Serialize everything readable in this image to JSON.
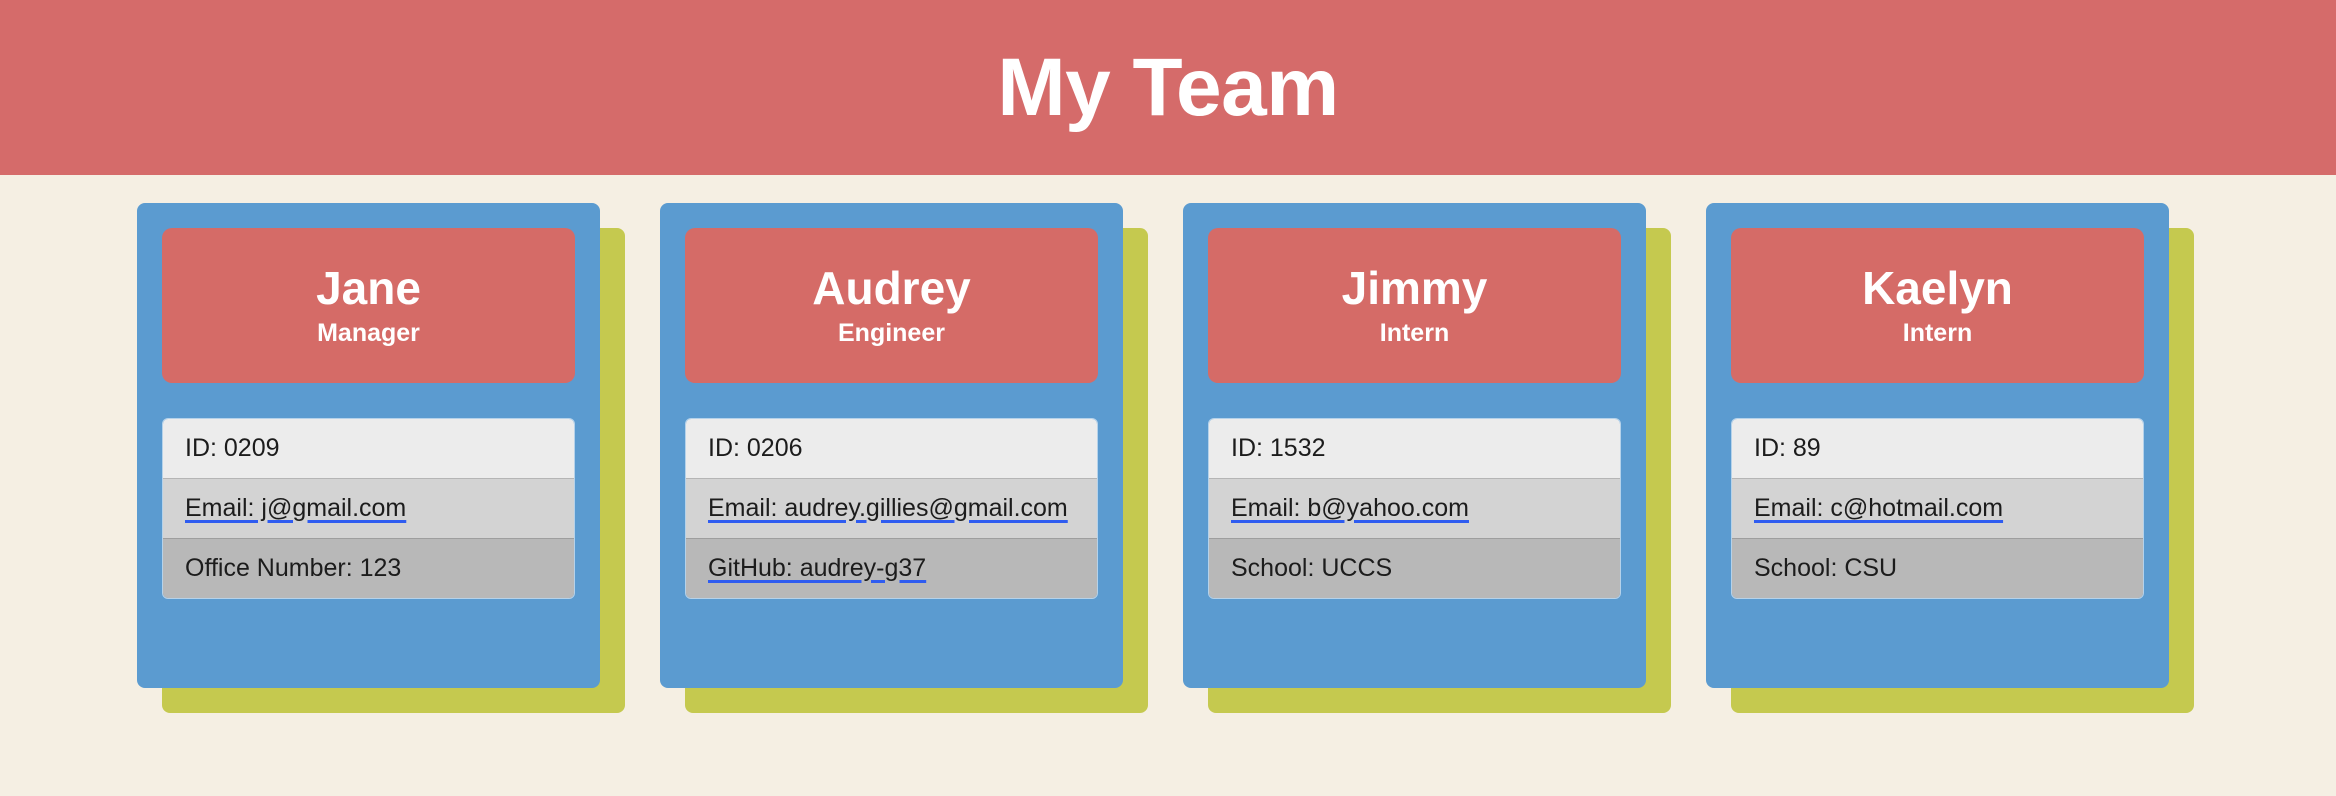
{
  "header": {
    "title": "My Team"
  },
  "colors": {
    "header_bar": "#d56b6a",
    "page_background": "#f5efe3",
    "card_background": "#5b9bd0",
    "card_header": "#d56b67",
    "card_shadow": "#c5c94f",
    "list_shade_light": "#ececec",
    "list_shade_medium": "#d3d3d3",
    "list_shade_dark": "#b8b8b8",
    "link_underline": "#2f5cf0"
  },
  "team": [
    {
      "name": "Jane",
      "role": "Manager",
      "details": [
        {
          "text": "ID: 0209",
          "link": false
        },
        {
          "text": "Email: j@gmail.com",
          "link": true
        },
        {
          "text": "Office Number: 123",
          "link": false
        }
      ]
    },
    {
      "name": "Audrey",
      "role": "Engineer",
      "details": [
        {
          "text": "ID: 0206",
          "link": false
        },
        {
          "text": "Email: audrey.gillies@gmail.com",
          "link": true
        },
        {
          "text": "GitHub: audrey-g37",
          "link": true
        }
      ]
    },
    {
      "name": "Jimmy",
      "role": "Intern",
      "details": [
        {
          "text": "ID: 1532",
          "link": false
        },
        {
          "text": "Email: b@yahoo.com",
          "link": true
        },
        {
          "text": "School: UCCS",
          "link": false
        }
      ]
    },
    {
      "name": "Kaelyn",
      "role": "Intern",
      "details": [
        {
          "text": "ID: 89",
          "link": false
        },
        {
          "text": "Email: c@hotmail.com",
          "link": true
        },
        {
          "text": "School: CSU",
          "link": false
        }
      ]
    }
  ]
}
